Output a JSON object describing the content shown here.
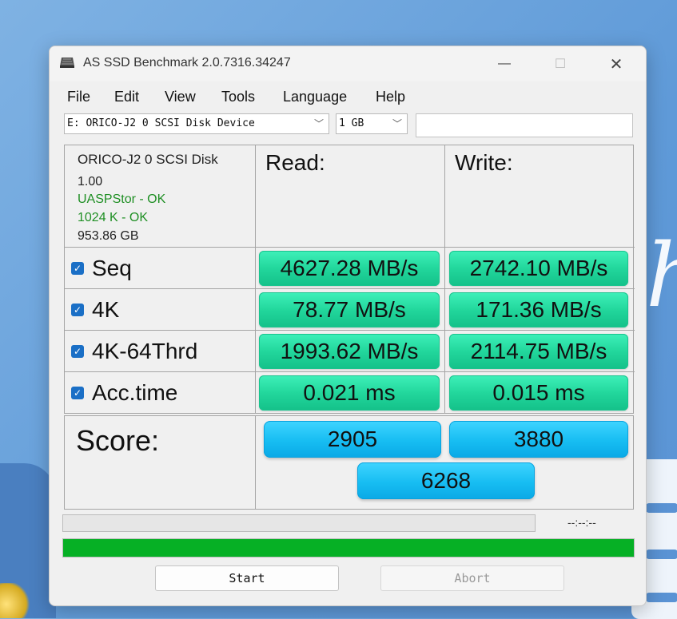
{
  "window": {
    "title": "AS SSD Benchmark 2.0.7316.34247"
  },
  "menu": [
    "File",
    "Edit",
    "View",
    "Tools",
    "Language",
    "Help"
  ],
  "toolbar": {
    "drive": "E: ORICO-J2 0 SCSI Disk Device",
    "size": "1 GB",
    "extra_value": ""
  },
  "drive_info": {
    "name": "ORICO-J2 0 SCSI Disk",
    "firmware": "1.00",
    "driver": "UASPStor - OK",
    "alignment": "1024 K - OK",
    "capacity": "953.86 GB"
  },
  "headers": {
    "read": "Read:",
    "write": "Write:"
  },
  "tests": [
    {
      "label": "Seq",
      "checked": true,
      "read": "4627.28 MB/s",
      "write": "2742.10 MB/s"
    },
    {
      "label": "4K",
      "checked": true,
      "read": "78.77 MB/s",
      "write": "171.36 MB/s"
    },
    {
      "label": "4K-64Thrd",
      "checked": true,
      "read": "1993.62 MB/s",
      "write": "2114.75 MB/s"
    },
    {
      "label": "Acc.time",
      "checked": true,
      "read": "0.021 ms",
      "write": "0.015 ms"
    }
  ],
  "score": {
    "label": "Score:",
    "read": "2905",
    "write": "3880",
    "total": "6268"
  },
  "progress": {
    "elapsed": "--:--:--",
    "test_fraction": 0.0,
    "overall_fraction": 1.0
  },
  "buttons": {
    "start": "Start",
    "abort": "Abort"
  },
  "colors": {
    "value_bg": "#22d79c",
    "score_bg": "#17bdf2",
    "progress": "#06b025",
    "ok_text": "#1f8f24"
  }
}
